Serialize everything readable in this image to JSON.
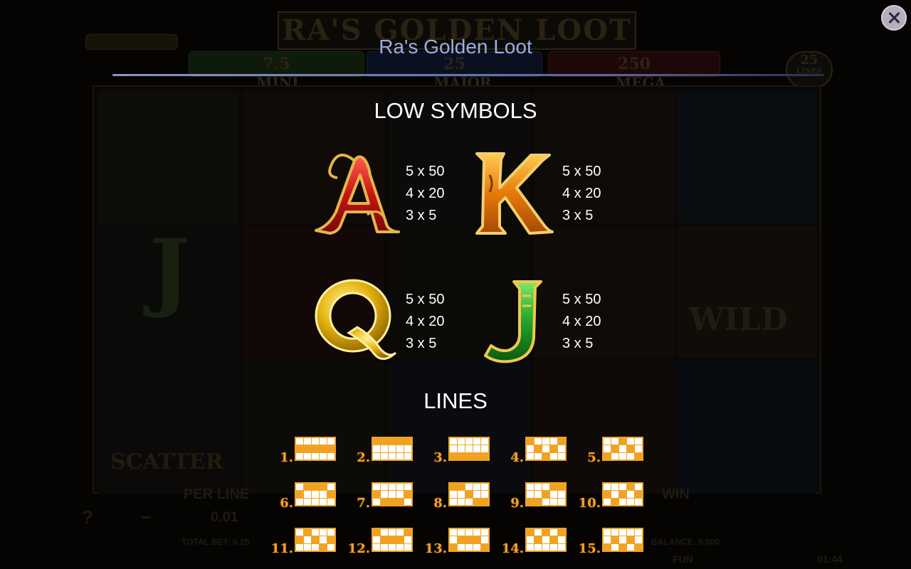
{
  "overlay": {
    "title": "Ra's Golden Loot",
    "low_symbols_title": "LOW SYMBOLS",
    "lines_title": "LINES"
  },
  "symbols": [
    {
      "letter": "A",
      "pays": [
        "5 x 50",
        "4 x 20",
        "3 x 5"
      ],
      "color": "#c81e1e"
    },
    {
      "letter": "K",
      "pays": [
        "5 x 50",
        "4 x 20",
        "3 x 5"
      ],
      "color": "#e87a10"
    },
    {
      "letter": "Q",
      "pays": [
        "5 x 50",
        "4 x 20",
        "3 x 5"
      ],
      "color": "#e3b40c"
    },
    {
      "letter": "J",
      "pays": [
        "5 x 50",
        "4 x 20",
        "3 x 5"
      ],
      "color": "#2aa32a"
    }
  ],
  "lines": [
    {
      "num": "1.",
      "rows": [
        1,
        1,
        1,
        1,
        1
      ]
    },
    {
      "num": "2.",
      "rows": [
        0,
        0,
        0,
        0,
        0
      ]
    },
    {
      "num": "3.",
      "rows": [
        2,
        2,
        2,
        2,
        2
      ]
    },
    {
      "num": "4.",
      "rows": [
        0,
        1,
        2,
        1,
        0
      ]
    },
    {
      "num": "5.",
      "rows": [
        2,
        1,
        0,
        1,
        2
      ]
    },
    {
      "num": "6.",
      "rows": [
        1,
        0,
        0,
        0,
        1
      ]
    },
    {
      "num": "7.",
      "rows": [
        1,
        2,
        2,
        2,
        1
      ]
    },
    {
      "num": "8.",
      "rows": [
        0,
        0,
        1,
        2,
        2
      ]
    },
    {
      "num": "9.",
      "rows": [
        2,
        2,
        1,
        0,
        0
      ]
    },
    {
      "num": "10.",
      "rows": [
        1,
        2,
        1,
        0,
        1
      ]
    },
    {
      "num": "11.",
      "rows": [
        1,
        0,
        1,
        2,
        1
      ]
    },
    {
      "num": "12.",
      "rows": [
        0,
        1,
        1,
        1,
        0
      ]
    },
    {
      "num": "13.",
      "rows": [
        2,
        1,
        1,
        1,
        2
      ]
    },
    {
      "num": "14.",
      "rows": [
        0,
        1,
        0,
        1,
        0
      ]
    },
    {
      "num": "15.",
      "rows": [
        2,
        1,
        2,
        1,
        2
      ]
    }
  ],
  "background": {
    "game_title": "RA'S GOLDEN LOOT",
    "mini_value": "7.5",
    "mini_label": "MINI",
    "major_value": "25",
    "major_label": "MAJOR",
    "mega_value": "250",
    "mega_label": "MEGA",
    "lines_count": "25",
    "lines_label": "LINES",
    "scatter": "SCATTER",
    "wild": "WILD",
    "per_line_label": "PER LINE",
    "per_line_value": "0.01",
    "win_label": "WIN",
    "total_bet": "TOTAL BET: 0.25",
    "balance": "BALANCE: 5,000",
    "fun": "FUN",
    "clock": "01:44"
  },
  "colors": {
    "title": "#9aaee6",
    "line_orange": "#f0a323",
    "close_button": "#b5aebd"
  }
}
